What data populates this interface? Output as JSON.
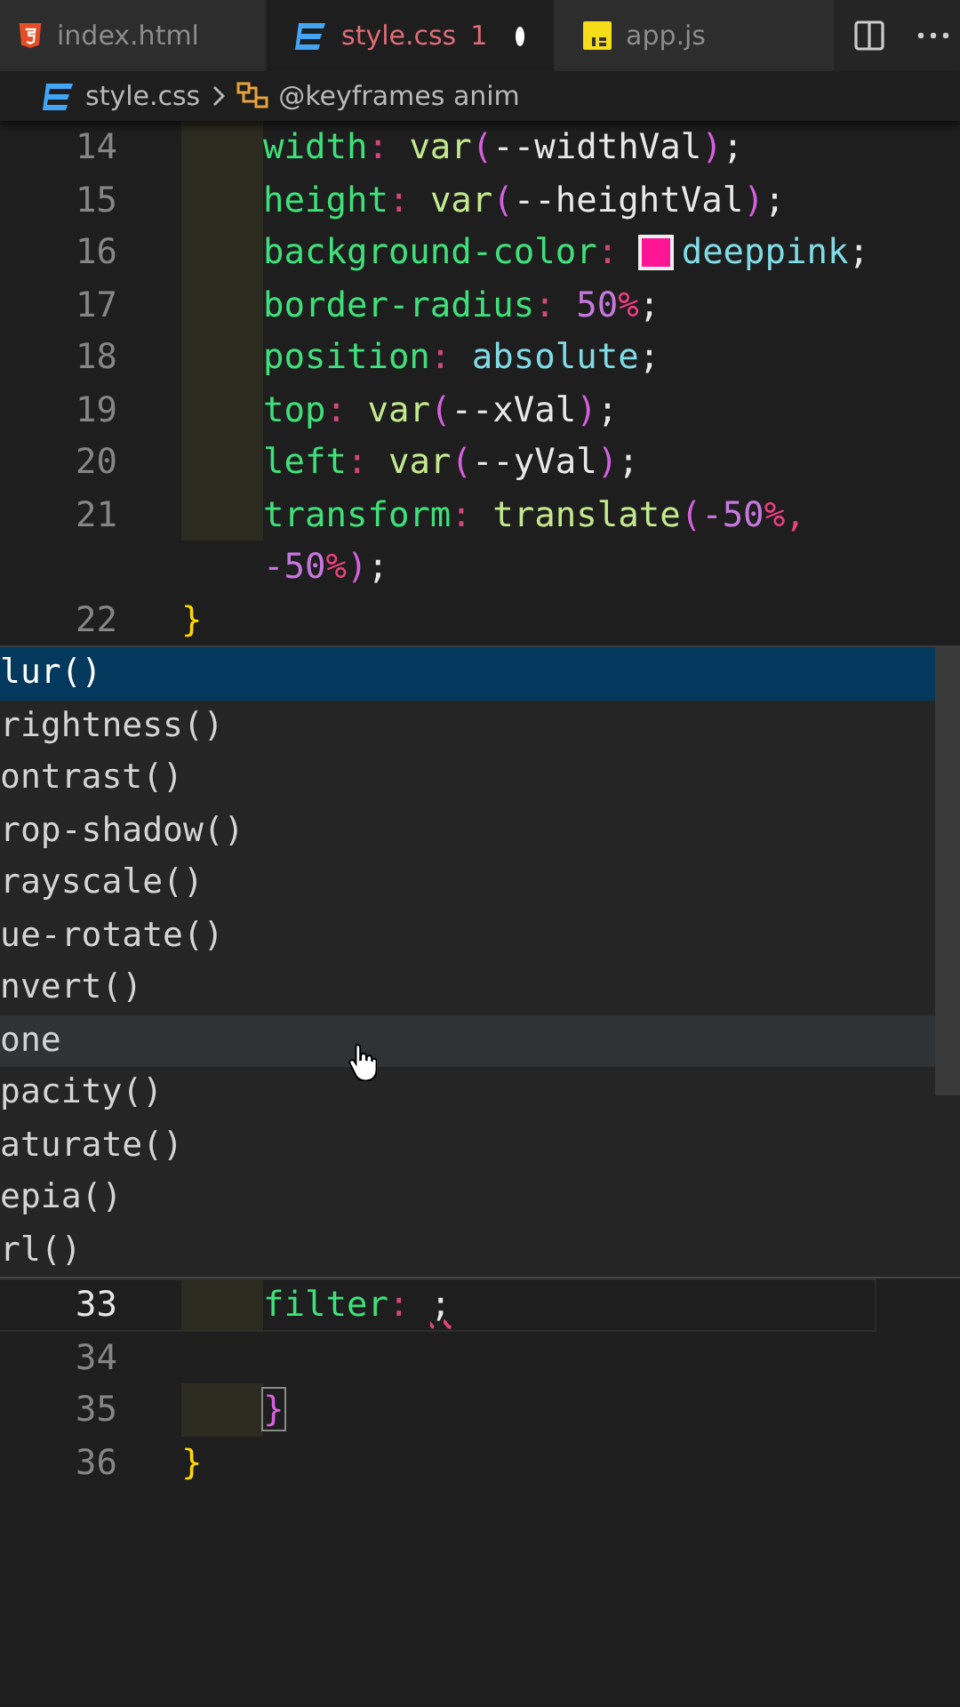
{
  "tabs": [
    {
      "label": "index.html",
      "kind": "html",
      "selected": false,
      "modified": false
    },
    {
      "label": "style.css",
      "kind": "css",
      "selected": true,
      "problems": "1",
      "modified": true
    },
    {
      "label": "app.js",
      "kind": "js",
      "selected": false,
      "modified": false
    }
  ],
  "breadcrumb": {
    "file": "style.css",
    "symbol": "@keyframes anim"
  },
  "lines_top": [
    {
      "number": "14",
      "indented": true,
      "shaded": true,
      "current": false,
      "tokens": [
        {
          "text": "width",
          "kind": "prop"
        },
        {
          "text": ": ",
          "kind": "colon"
        },
        {
          "text": "var",
          "kind": "func"
        },
        {
          "text": "(",
          "kind": "paren"
        },
        {
          "text": "--widthVal",
          "kind": "plain"
        },
        {
          "text": ")",
          "kind": "paren"
        },
        {
          "text": ";",
          "kind": "punct"
        }
      ]
    },
    {
      "number": "15",
      "indented": true,
      "shaded": true,
      "current": false,
      "tokens": [
        {
          "text": "height",
          "kind": "prop"
        },
        {
          "text": ": ",
          "kind": "colon"
        },
        {
          "text": "var",
          "kind": "func"
        },
        {
          "text": "(",
          "kind": "paren"
        },
        {
          "text": "--heightVal",
          "kind": "plain"
        },
        {
          "text": ")",
          "kind": "paren"
        },
        {
          "text": ";",
          "kind": "punct"
        }
      ]
    },
    {
      "number": "16",
      "indented": true,
      "shaded": true,
      "current": false,
      "tokens": [
        {
          "text": "background-color",
          "kind": "prop"
        },
        {
          "text": ": ",
          "kind": "colon"
        },
        {
          "kind": "swatch",
          "color": "#ff1493"
        },
        {
          "text": "deeppink",
          "kind": "value"
        },
        {
          "text": ";",
          "kind": "punct"
        }
      ]
    },
    {
      "number": "17",
      "indented": true,
      "shaded": true,
      "current": false,
      "tokens": [
        {
          "text": "border-radius",
          "kind": "prop"
        },
        {
          "text": ": ",
          "kind": "colon"
        },
        {
          "text": "50",
          "kind": "num"
        },
        {
          "text": "%",
          "kind": "unit"
        },
        {
          "text": ";",
          "kind": "punct"
        }
      ]
    },
    {
      "number": "18",
      "indented": true,
      "shaded": true,
      "current": false,
      "tokens": [
        {
          "text": "position",
          "kind": "prop"
        },
        {
          "text": ": ",
          "kind": "colon"
        },
        {
          "text": "absolute",
          "kind": "value"
        },
        {
          "text": ";",
          "kind": "punct"
        }
      ]
    },
    {
      "number": "19",
      "indented": true,
      "shaded": true,
      "current": false,
      "tokens": [
        {
          "text": "top",
          "kind": "prop"
        },
        {
          "text": ": ",
          "kind": "colon"
        },
        {
          "text": "var",
          "kind": "func"
        },
        {
          "text": "(",
          "kind": "paren"
        },
        {
          "text": "--xVal",
          "kind": "plain"
        },
        {
          "text": ")",
          "kind": "paren"
        },
        {
          "text": ";",
          "kind": "punct"
        }
      ]
    },
    {
      "number": "20",
      "indented": true,
      "shaded": true,
      "current": false,
      "tokens": [
        {
          "text": "left",
          "kind": "prop"
        },
        {
          "text": ": ",
          "kind": "colon"
        },
        {
          "text": "var",
          "kind": "func"
        },
        {
          "text": "(",
          "kind": "paren"
        },
        {
          "text": "--yVal",
          "kind": "plain"
        },
        {
          "text": ")",
          "kind": "paren"
        },
        {
          "text": ";",
          "kind": "punct"
        }
      ]
    },
    {
      "number": "21",
      "indented": true,
      "shaded": true,
      "current": false,
      "tokens": [
        {
          "text": "transform",
          "kind": "prop"
        },
        {
          "text": ": ",
          "kind": "colon"
        },
        {
          "text": "translate",
          "kind": "func"
        },
        {
          "text": "(",
          "kind": "paren"
        },
        {
          "text": "-50",
          "kind": "num"
        },
        {
          "text": "%,",
          "kind": "unit"
        }
      ],
      "wrap": [
        {
          "text": "-50",
          "kind": "num"
        },
        {
          "text": "%",
          "kind": "unit"
        },
        {
          "text": ")",
          "kind": "paren"
        },
        {
          "text": ";",
          "kind": "punct"
        }
      ]
    },
    {
      "number": "22",
      "indented": false,
      "shaded": false,
      "current": false,
      "tokens": [
        {
          "text": "}",
          "kind": "brace"
        }
      ]
    }
  ],
  "suggestions": [
    {
      "label": "lur()",
      "selected": true,
      "hovered": false
    },
    {
      "label": "rightness()",
      "selected": false,
      "hovered": false
    },
    {
      "label": "ontrast()",
      "selected": false,
      "hovered": false
    },
    {
      "label": "rop-shadow()",
      "selected": false,
      "hovered": false
    },
    {
      "label": "rayscale()",
      "selected": false,
      "hovered": false
    },
    {
      "label": "ue-rotate()",
      "selected": false,
      "hovered": false
    },
    {
      "label": "nvert()",
      "selected": false,
      "hovered": false
    },
    {
      "label": "one",
      "selected": false,
      "hovered": true
    },
    {
      "label": "pacity()",
      "selected": false,
      "hovered": false
    },
    {
      "label": "aturate()",
      "selected": false,
      "hovered": false
    },
    {
      "label": "epia()",
      "selected": false,
      "hovered": false
    },
    {
      "label": "rl()",
      "selected": false,
      "hovered": false
    }
  ],
  "lines_bottom": [
    {
      "number": "33",
      "indented": true,
      "shaded": true,
      "current": true,
      "tokens": [
        {
          "text": "filter",
          "kind": "prop"
        },
        {
          "text": ": ",
          "kind": "colon"
        },
        {
          "text": ";",
          "kind": "error"
        }
      ]
    },
    {
      "number": "34",
      "current": false
    },
    {
      "number": "35",
      "indented": true,
      "shaded": true,
      "current": false,
      "tokens": [
        {
          "text": "}",
          "kind": "match"
        }
      ]
    },
    {
      "number": "36",
      "indented": false,
      "shaded": false,
      "current": false,
      "tokens": [
        {
          "text": "}",
          "kind": "brace"
        }
      ]
    }
  ]
}
